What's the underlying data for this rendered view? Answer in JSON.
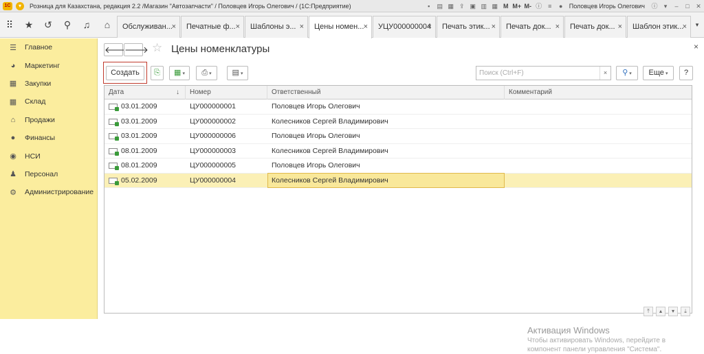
{
  "titlebar": {
    "logo": "1С",
    "title": "Розница для Казахстана, редакция 2.2 /Магазин \"Автозапчасти\" / Половцев Игорь Олегович /  (1С:Предприятие)",
    "m1": "M",
    "m2": "M+",
    "m3": "M-",
    "user": "Половцев Игорь Олегович"
  },
  "tabs": [
    {
      "label": "Обслуживан..."
    },
    {
      "label": "Печатные ф..."
    },
    {
      "label": "Шаблоны э..."
    },
    {
      "label": "Цены номен..."
    },
    {
      "label": "УЦУ000000004"
    },
    {
      "label": "Печать этик..."
    },
    {
      "label": "Печать док..."
    },
    {
      "label": "Печать док..."
    },
    {
      "label": "Шаблон этик..."
    }
  ],
  "sidebar": {
    "items": [
      {
        "label": "Главное",
        "icon": "menu-icon"
      },
      {
        "label": "Маркетинг",
        "icon": "pie-icon"
      },
      {
        "label": "Закупки",
        "icon": "cart-icon"
      },
      {
        "label": "Склад",
        "icon": "warehouse-icon"
      },
      {
        "label": "Продажи",
        "icon": "shop-icon"
      },
      {
        "label": "Финансы",
        "icon": "coins-icon"
      },
      {
        "label": "НСИ",
        "icon": "db-icon"
      },
      {
        "label": "Персонал",
        "icon": "person-icon"
      },
      {
        "label": "Администрирование",
        "icon": "gear-icon"
      }
    ]
  },
  "form": {
    "title": "Цены номенклатуры",
    "create_label": "Создать",
    "search_placeholder": "Поиск (Ctrl+F)",
    "more_label": "Еще",
    "help_label": "?"
  },
  "table": {
    "columns": [
      "Дата",
      "Номер",
      "Ответственный",
      "Комментарий"
    ],
    "sort_marker": "↓",
    "rows": [
      {
        "date": "03.01.2009",
        "number": "ЦУ000000001",
        "resp": "Половцев Игорь Олегович",
        "comment": ""
      },
      {
        "date": "03.01.2009",
        "number": "ЦУ000000002",
        "resp": "Колесников Сергей Владимирович",
        "comment": ""
      },
      {
        "date": "03.01.2009",
        "number": "ЦУ000000006",
        "resp": "Половцев Игорь Олегович",
        "comment": ""
      },
      {
        "date": "08.01.2009",
        "number": "ЦУ000000003",
        "resp": "Колесников Сергей Владимирович",
        "comment": ""
      },
      {
        "date": "08.01.2009",
        "number": "ЦУ000000005",
        "resp": "Половцев Игорь Олегович",
        "comment": ""
      },
      {
        "date": "05.02.2009",
        "number": "ЦУ000000004",
        "resp": "Колесников Сергей Владимирович",
        "comment": "",
        "selected": true
      }
    ]
  },
  "watermark": {
    "line1": "Активация Windows",
    "line2": "Чтобы активировать Windows, перейдите в",
    "line3": "компонент панели управления \"Система\"."
  }
}
